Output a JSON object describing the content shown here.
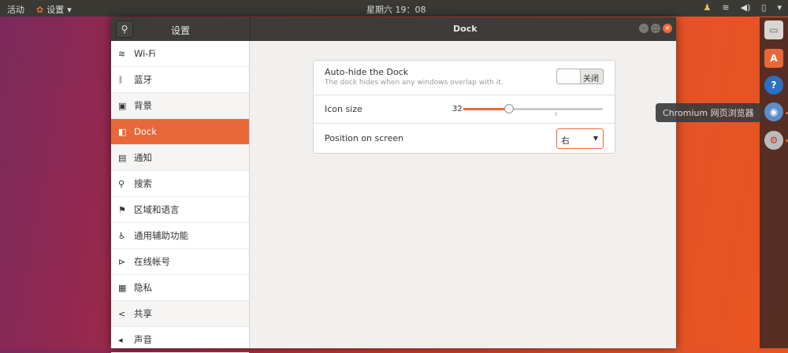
{
  "topbar": {
    "activities": "活动",
    "app_menu": "设置",
    "clock": "星期六 19：08"
  },
  "window": {
    "sidebar_title": "设置",
    "panel_title": "Dock"
  },
  "sidebar": {
    "items": [
      {
        "label": "Wi-Fi",
        "icon": "wifi-icon",
        "glyph": "≋"
      },
      {
        "label": "蓝牙",
        "icon": "bluetooth-icon",
        "glyph": "ᛒ"
      },
      {
        "label": "背景",
        "icon": "background-icon",
        "glyph": "▣"
      },
      {
        "label": "Dock",
        "icon": "dock-icon",
        "glyph": "◧"
      },
      {
        "label": "通知",
        "icon": "notifications-icon",
        "glyph": "▤"
      },
      {
        "label": "搜索",
        "icon": "search-icon",
        "glyph": "⚲"
      },
      {
        "label": "区域和语言",
        "icon": "region-icon",
        "glyph": "⚑"
      },
      {
        "label": "通用辅助功能",
        "icon": "accessibility-icon",
        "glyph": "♿"
      },
      {
        "label": "在线帐号",
        "icon": "online-accounts-icon",
        "glyph": "⊳"
      },
      {
        "label": "隐私",
        "icon": "privacy-icon",
        "glyph": "▦"
      },
      {
        "label": "共享",
        "icon": "share-icon",
        "glyph": "<"
      },
      {
        "label": "声音",
        "icon": "sound-icon",
        "glyph": "◂"
      }
    ],
    "selected": "Dock"
  },
  "dock_settings": {
    "autohide": {
      "label": "Auto-hide the Dock",
      "description": "The dock hides when any windows overlap with it.",
      "state": "关闭"
    },
    "icon_size": {
      "label": "Icon size",
      "value": "32",
      "min": 16,
      "max": 64,
      "fraction": 0.33
    },
    "position": {
      "label": "Position on screen",
      "value": "右"
    }
  },
  "tooltip": "Chromium 网页浏览器",
  "colors": {
    "accent": "#e9683a"
  }
}
